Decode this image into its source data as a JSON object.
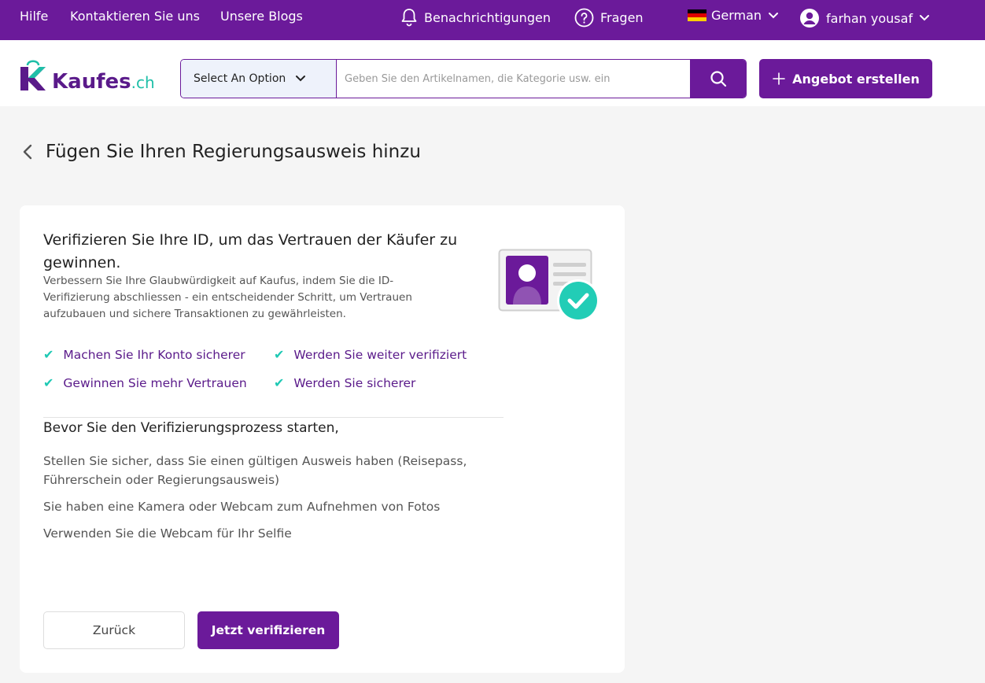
{
  "topbar": {
    "links": [
      "Hilfe",
      "Kontaktieren Sie uns",
      "Unsere Blogs"
    ],
    "notifications_label": "Benachrichtigungen",
    "questions_label": "Fragen",
    "language_label": "German",
    "user_name": "farhan yousaf"
  },
  "header": {
    "logo_main": "Kaufes",
    "logo_suffix": ".ch",
    "category_select": "Select An Option",
    "search_placeholder": "Geben Sie den Artikelnamen, die Kategorie usw. ein",
    "create_offer_label": "Angebot erstellen"
  },
  "page": {
    "title": "Fügen Sie Ihren Regierungsausweis hinzu"
  },
  "card": {
    "heading": "Verifizieren Sie Ihre ID, um das Vertrauen der Käufer zu gewinnen.",
    "description": "Verbessern Sie Ihre Glaubwürdigkeit auf Kaufus, indem Sie die ID-Verifizierung abschliessen - ein entscheidender Schritt, um Vertrauen aufzubauen und sichere Transaktionen zu gewährleisten.",
    "benefits": [
      "Machen Sie Ihr Konto sicherer",
      "Werden Sie weiter verifiziert",
      "Gewinnen Sie mehr Vertrauen",
      "Werden Sie sicherer"
    ],
    "before_title": "Bevor Sie den Verifizierungsprozess starten,",
    "requirements": [
      "Stellen Sie sicher, dass Sie einen gültigen Ausweis haben (Reisepass, Führerschein oder Regierungsausweis)",
      "Sie haben eine Kamera oder Webcam zum Aufnehmen von Fotos",
      "Verwenden Sie die Webcam für Ihr Selfie"
    ],
    "back_label": "Zurück",
    "verify_label": "Jetzt verifizieren"
  },
  "colors": {
    "brand_purple": "#6b1a9a",
    "accent_teal": "#1fc9b4"
  }
}
